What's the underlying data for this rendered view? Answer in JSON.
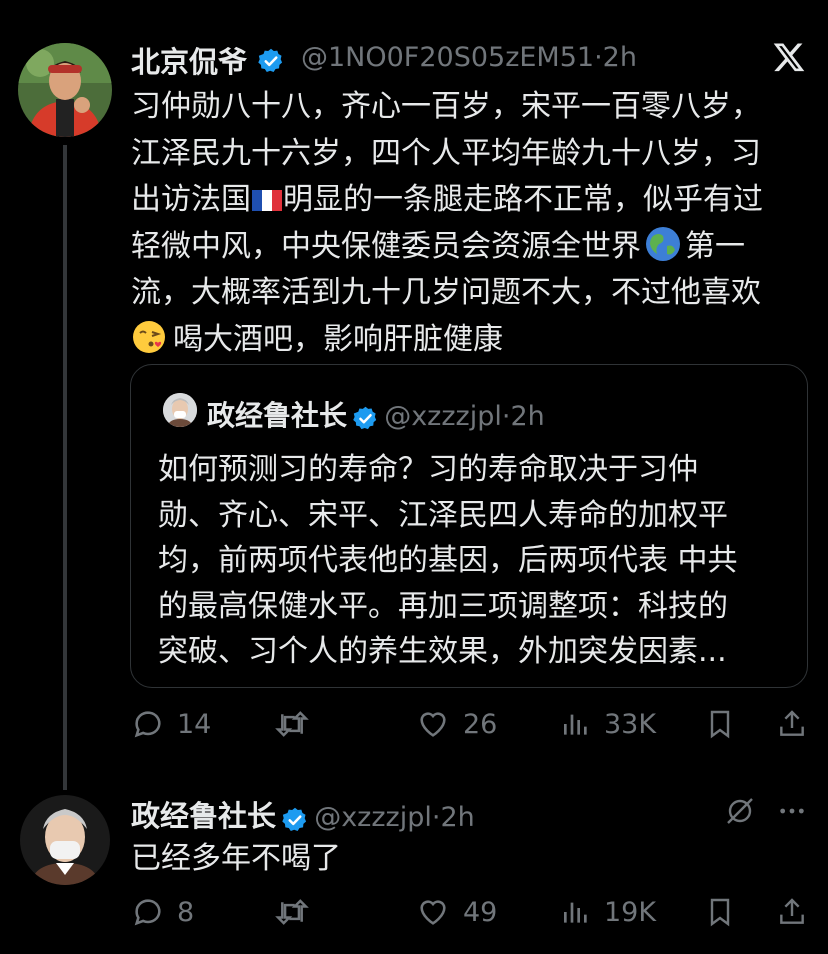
{
  "tweet": {
    "author_name": "北京侃爷",
    "author_handle": "@1NO0F20S05zEM51",
    "time": "2h",
    "lines": [
      "习仲勋八十八，齐心一百岁，宋平一百零八岁，",
      "江泽民九十六岁，四个人平均年龄九十八岁，习",
      [
        "出访法国",
        "明显的一条腿走路不正常，似乎有过"
      ],
      [
        "轻微中风，中央保健委员会资源全世界",
        "第一"
      ],
      "流，大概率活到九十几岁问题不大，不过他喜欢",
      "喝大酒吧，影响肝脏健康"
    ],
    "emoji": {
      "flag": "french-flag",
      "globe": "globe-asia-australia",
      "face": "face-blowing-a-kiss"
    },
    "quote": {
      "author_name": "政经鲁社长",
      "author_handle": "@xzzzjpl",
      "time": "2h",
      "lines": [
        "如何预测习的寿命？习的寿命取决于习仲",
        "勋、齐心、宋平、江泽民四人寿命的加权平",
        "均，前两项代表他的基因，后两项代表 中共",
        "的最高保健水平。再加三项调整项：科技的",
        "突破、习个人的养生效果，外加突发因素..."
      ]
    },
    "actions": {
      "replies": "14",
      "retweets": "",
      "likes": "26",
      "views": "33K"
    }
  },
  "reply": {
    "author_name": "政经鲁社长",
    "author_handle": "@xzzzjpl",
    "time": "2h",
    "text": "已经多年不喝了",
    "actions": {
      "replies": "8",
      "retweets": "",
      "likes": "49",
      "views": "19K"
    }
  },
  "colors": {
    "background": "#000000",
    "text": "#e7e9ea",
    "secondary": "#71767b",
    "verified": "#1d9bf0",
    "border": "#2f3336"
  },
  "icons": [
    "x-logo-icon",
    "verified-badge-icon",
    "reply-icon",
    "retweet-icon",
    "like-icon",
    "views-icon",
    "bookmark-icon",
    "share-icon",
    "grok-icon",
    "more-icon"
  ]
}
